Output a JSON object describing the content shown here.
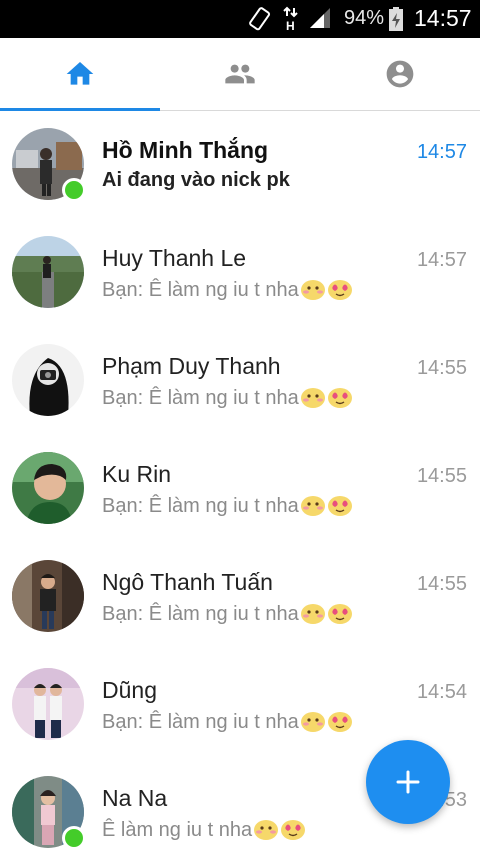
{
  "status_bar": {
    "battery_percent": "94%",
    "time": "14:57"
  },
  "tabs": [
    {
      "name": "home",
      "icon": "home-icon",
      "active": true
    },
    {
      "name": "people",
      "icon": "people-icon",
      "active": false
    },
    {
      "name": "profile",
      "icon": "account-circle-icon",
      "active": false
    }
  ],
  "colors": {
    "accent": "#1e88e5",
    "online": "#44cc2a"
  },
  "conversations": [
    {
      "name": "Hồ Minh Thắng",
      "snippet": "Ai đang vào nick pk",
      "time": "14:57",
      "unread": true,
      "online": true
    },
    {
      "name": "Huy Thanh Le",
      "snippet": "Bạn: Ê làm ng iu t nha",
      "time": "14:57",
      "unread": false,
      "online": false
    },
    {
      "name": "Phạm Duy Thanh",
      "snippet": "Bạn: Ê làm ng iu t nha",
      "time": "14:55",
      "unread": false,
      "online": false
    },
    {
      "name": "Ku Rin",
      "snippet": "Bạn: Ê làm ng iu t nha",
      "time": "14:55",
      "unread": false,
      "online": false
    },
    {
      "name": "Ngô Thanh Tuấn",
      "snippet": "Bạn: Ê làm ng iu t nha",
      "time": "14:55",
      "unread": false,
      "online": false
    },
    {
      "name": "Dũng",
      "snippet": "Bạn: Ê làm ng iu t nha",
      "time": "14:54",
      "unread": false,
      "online": false
    },
    {
      "name": "Na Na",
      "snippet": "Ê làm ng iu t nha",
      "time": "14:53",
      "unread": false,
      "online": true
    }
  ],
  "fab": {
    "icon": "plus-icon"
  }
}
